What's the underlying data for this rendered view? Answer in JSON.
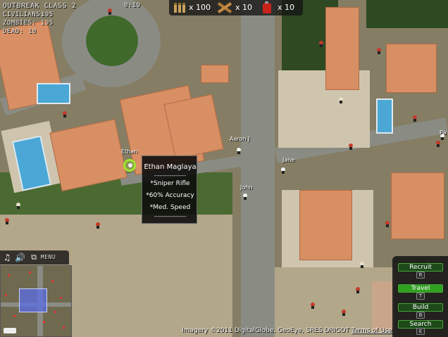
{
  "hud": {
    "game_title": "OUTBREAK CLASS 2",
    "timer": "0:19",
    "civilians_label": "CIVILIANS:",
    "civilians_value": "195",
    "zombies_label": "ZOMBIES:",
    "zombies_value": "195",
    "dead_label": "DEAD:",
    "dead_value": "10"
  },
  "resources": {
    "ammo": {
      "icon": "ammo-icon",
      "value": "x 100"
    },
    "planks": {
      "icon": "planks-icon",
      "value": "x 10"
    },
    "fuel": {
      "icon": "fuel-can-icon",
      "value": "x 10"
    }
  },
  "units": {
    "selected": "Ethan",
    "labels": [
      "Ethan",
      "Aaron J",
      "Jane",
      "John",
      "Pa"
    ]
  },
  "tooltip": {
    "name": "Ethan Maglaya",
    "divider": "------------------",
    "weapon": "*Sniper Rifle",
    "accuracy": "*60% Accuracy",
    "speed": "*Med. Speed",
    "divider2": "------------------"
  },
  "controls": {
    "icons": [
      "music-icon",
      "sound-icon",
      "fullscreen-icon"
    ],
    "menu_label": "MENU"
  },
  "actions": [
    {
      "label": "Recruit",
      "key": "R",
      "state": "off"
    },
    {
      "label": "Travel",
      "key": "T",
      "state": "on"
    },
    {
      "label": "Build",
      "key": "B",
      "state": "off"
    },
    {
      "label": "Search",
      "key": "E",
      "state": "off"
    }
  ],
  "attribution": {
    "text": "Imagery ©2011 DigitalGlobe, GeoEye, SRES DRIGOT",
    "link": "Terms of Use"
  },
  "colors": {
    "zombie": "#c23a2a",
    "active_button": "#2fa020",
    "selection_ring": "#9be62c"
  }
}
